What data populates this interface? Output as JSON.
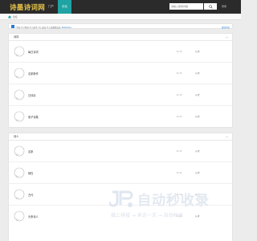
{
  "header": {
    "logo": "诗墨诗词网",
    "tabs": [
      {
        "label": "门户",
        "active": false
      },
      {
        "label": "论坛",
        "active": true
      }
    ],
    "search": {
      "placeholder": "请输入搜索内容"
    },
    "login": "登录"
  },
  "breadcrumb": {
    "label": "论坛"
  },
  "stats": {
    "text": "今日: 0 | 昨日: 0 | 帖子: 0 | 会员: 0 | 欢迎新会员:",
    "new_member": "PanfuGou",
    "mark_read": "版块导航"
  },
  "sections": [
    {
      "title": "诗词",
      "forums": [
        {
          "name": "每日诗词",
          "count": "0 / 0",
          "last": "从未"
        },
        {
          "name": "名家新作",
          "count": "0 / 0",
          "last": "从未"
        },
        {
          "name": "日诗杂",
          "count": "0 / 0",
          "last": "从未"
        },
        {
          "name": "电子诗集",
          "count": "0 / 0",
          "last": "从未"
        }
      ]
    },
    {
      "title": "诗人",
      "forums": [
        {
          "name": "名家",
          "count": "0 / 0",
          "last": "从未"
        },
        {
          "name": "现在",
          "count": "0 / 0",
          "last": "从未"
        },
        {
          "name": "古代",
          "count": "0 / 0",
          "last": "从未"
        },
        {
          "name": "头条诗人",
          "count": "0 / 0",
          "last": "从未"
        }
      ]
    }
  ],
  "watermark": {
    "title": "自动秒收录",
    "subtitle": "做上排接 → 来访一次 → 自动收录"
  }
}
